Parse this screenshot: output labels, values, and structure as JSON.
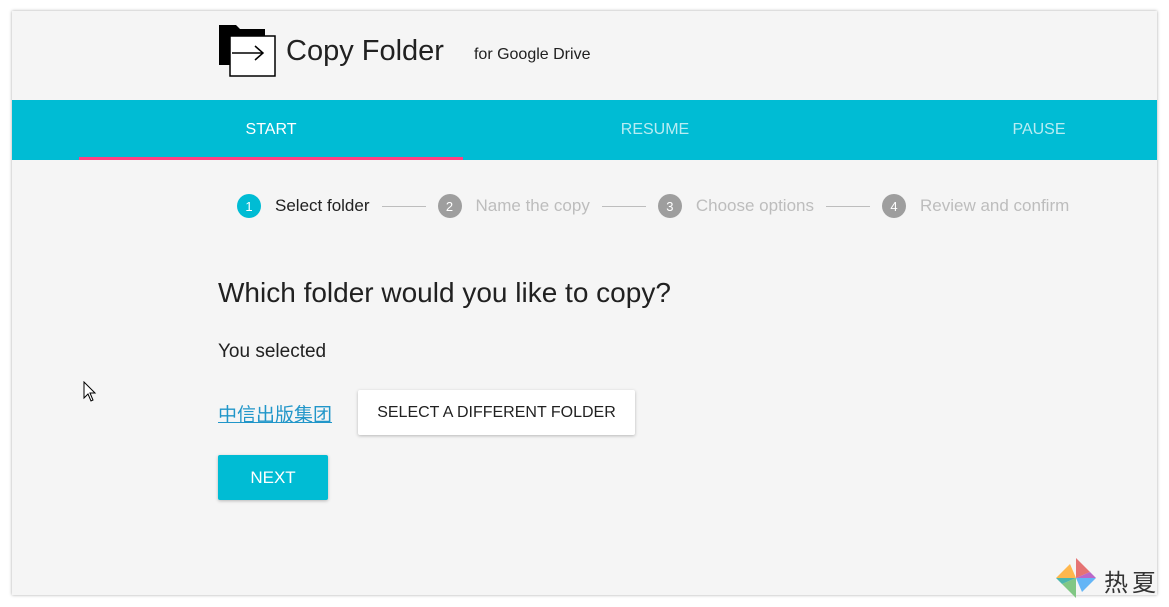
{
  "app": {
    "title": "Copy Folder",
    "subtitle": "for Google Drive",
    "logo_icon": "folder-copy-icon"
  },
  "tabs": [
    {
      "label": "START",
      "active": true
    },
    {
      "label": "RESUME",
      "active": false
    },
    {
      "label": "PAUSE",
      "active": false
    }
  ],
  "stepper": {
    "steps": [
      {
        "number": "1",
        "label": "Select folder",
        "active": true
      },
      {
        "number": "2",
        "label": "Name the copy",
        "active": false
      },
      {
        "number": "3",
        "label": "Choose options",
        "active": false
      },
      {
        "number": "4",
        "label": "Review and confirm",
        "active": false
      }
    ]
  },
  "main": {
    "heading": "Which folder would you like to copy?",
    "selected_label": "You selected",
    "selected_folder": "中信出版集团",
    "select_different_label": "SELECT A DIFFERENT FOLDER",
    "next_label": "NEXT"
  },
  "watermark": {
    "text": "热夏",
    "icon": "pinwheel-icon"
  },
  "colors": {
    "accent": "#00bcd4",
    "tab_indicator": "#ff4081",
    "link": "#2196c9",
    "step_inactive": "#9e9e9e",
    "step_label_inactive": "#bdbdbd"
  }
}
